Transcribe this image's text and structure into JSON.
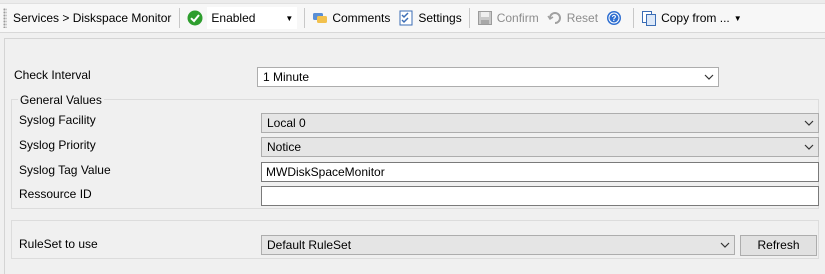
{
  "toolbar": {
    "breadcrumb": "Services > Diskspace Monitor",
    "enabled_value": "Enabled",
    "comments_label": "Comments",
    "settings_label": "Settings",
    "confirm_label": "Confirm",
    "reset_label": "Reset",
    "copy_from_label": "Copy from ..."
  },
  "form": {
    "check_interval": {
      "label": "Check Interval",
      "value": "1 Minute"
    },
    "general_values_title": "General Values",
    "syslog_facility": {
      "label": "Syslog Facility",
      "value": "Local 0"
    },
    "syslog_priority": {
      "label": "Syslog Priority",
      "value": "Notice"
    },
    "syslog_tag": {
      "label": "Syslog Tag Value",
      "value": "MWDiskSpaceMonitor"
    },
    "resource_id": {
      "label": "Ressource ID",
      "value": ""
    },
    "ruleset": {
      "label": "RuleSet to use",
      "value": "Default RuleSet"
    },
    "refresh_label": "Refresh"
  },
  "colors": {
    "accent_enabled": "#2e9e2e",
    "help_blue": "#2f6fd1"
  }
}
